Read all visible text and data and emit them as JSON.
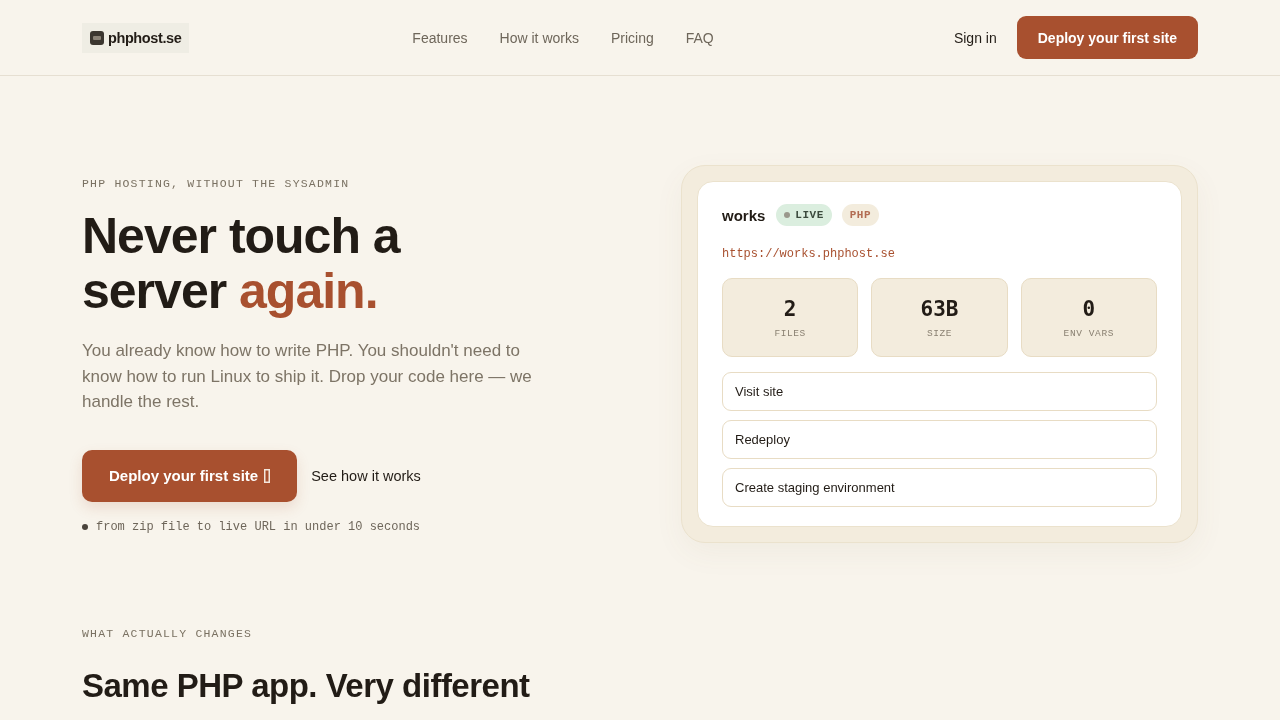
{
  "header": {
    "logo": {
      "text": "phphost.se"
    },
    "nav": [
      {
        "label": "Features"
      },
      {
        "label": "How it works"
      },
      {
        "label": "Pricing"
      },
      {
        "label": "FAQ"
      }
    ],
    "sign_in": "Sign in",
    "cta": "Deploy your first site"
  },
  "hero": {
    "eyebrow": "PHP HOSTING, WITHOUT THE SYSADMIN",
    "headline": {
      "lead": "Never touch a server",
      "accent": "again."
    },
    "subtitle": "You already know how to write PHP. You shouldn't need to know how to run Linux to ship it. Drop your code here — we handle the rest.",
    "primary_button": "Deploy your first site",
    "secondary_link": "See how it works",
    "note": "from zip file to live URL in under 10 seconds"
  },
  "site_card": {
    "name": "works",
    "badges": [
      {
        "label": "LIVE",
        "kind": "status"
      },
      {
        "label": "PHP",
        "kind": "tag"
      }
    ],
    "url": "https://works.phphost.se",
    "stats": [
      {
        "value": "2",
        "label": "FILES"
      },
      {
        "value": "63B",
        "label": "SIZE"
      },
      {
        "value": "0",
        "label": "ENV VARS"
      }
    ],
    "actions": [
      {
        "label": "Visit site"
      },
      {
        "label": "Redeploy"
      },
      {
        "label": "Create staging environment"
      }
    ]
  },
  "section": {
    "eyebrow": "WHAT ACTUALLY CHANGES",
    "title": "Same PHP app. Very different"
  }
}
